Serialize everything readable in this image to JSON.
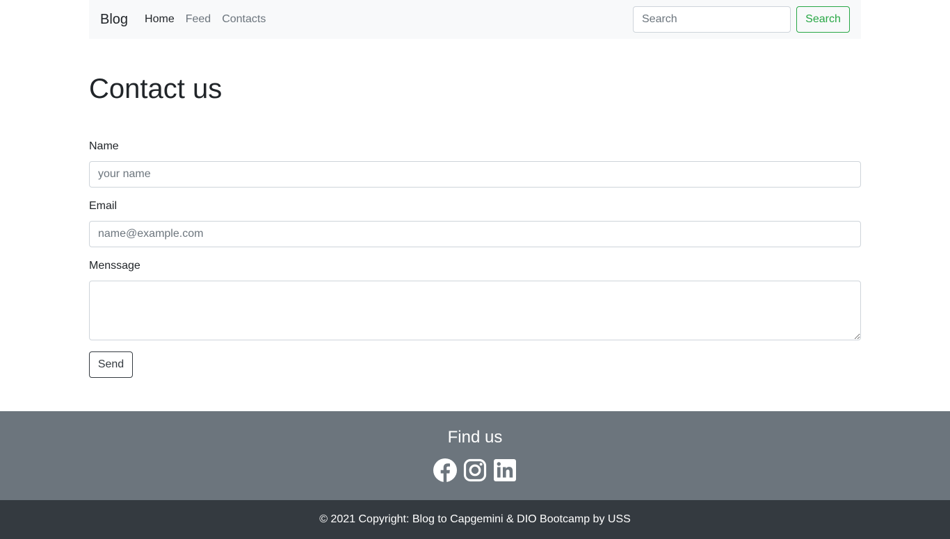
{
  "navbar": {
    "brand": "Blog",
    "links": [
      {
        "label": "Home",
        "active": true
      },
      {
        "label": "Feed",
        "active": false
      },
      {
        "label": "Contacts",
        "active": false
      }
    ],
    "search_placeholder": "Search",
    "search_button": "Search"
  },
  "main": {
    "title": "Contact us",
    "name_label": "Name",
    "name_placeholder": "your name",
    "email_label": "Email",
    "email_placeholder": "name@example.com",
    "message_label": "Menssage",
    "send_button": "Send"
  },
  "footer": {
    "heading": "Find us",
    "social_icons": [
      "facebook-icon",
      "instagram-icon",
      "linkedin-icon"
    ],
    "copyright": "© 2021 Copyright: Blog to Capgemini & DIO Bootcamp by USS"
  },
  "colors": {
    "navbar_bg": "#f8f9fa",
    "success": "#28a745",
    "footer_top_bg": "#6c757d",
    "footer_bottom_bg": "#343a40"
  }
}
